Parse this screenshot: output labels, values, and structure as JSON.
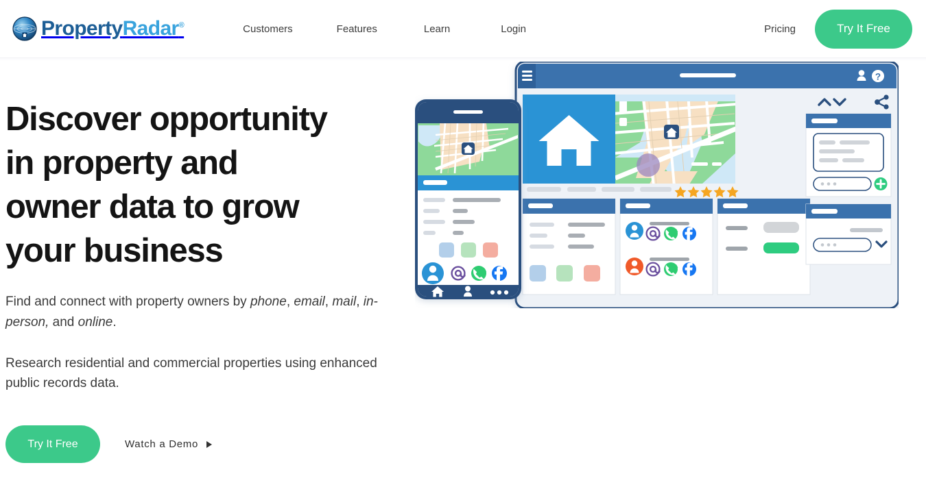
{
  "header": {
    "logo": {
      "icon": "globe-radar-icon",
      "word1": "Property",
      "word2": "Radar",
      "registered": "®"
    },
    "nav": [
      {
        "label": "Customers",
        "name": "customers"
      },
      {
        "label": "Features",
        "name": "features"
      },
      {
        "label": "Learn",
        "name": "learn"
      },
      {
        "label": "Login",
        "name": "login"
      }
    ],
    "pricing_label": "Pricing",
    "cta_label": "Try It Free"
  },
  "hero": {
    "title_line1": "Discover opportunity",
    "title_line2": "in property and",
    "title_line3": "owner data to grow",
    "title_line4": "your business",
    "sub_lead": "Find and connect with property owners by ",
    "sub_em1": "phone",
    "sub_sep1": ", ",
    "sub_em2": "email",
    "sub_sep2": ", ",
    "sub_em3": "mail",
    "sub_sep3": ", ",
    "sub_em4": "in-person,",
    "sub_and": " and ",
    "sub_em5": "online",
    "sub_end": ".",
    "paragraph2": "Research residential and commercial properties using enhanced public records data.",
    "cta_primary": "Try It Free",
    "cta_secondary": "Watch a Demo",
    "cta_secondary_icon": "play-triangle-icon"
  },
  "illustration": {
    "name": "property-app-illustration",
    "phone": {
      "name": "mobile-phone-mockup",
      "status_bar_icon": "speaker-bar",
      "map_pin_icon": "home-pin-icon",
      "bottom_nav": [
        "home-icon",
        "person-icon",
        "more-dots-icon"
      ],
      "contact_icons": [
        "person-avatar-icon",
        "email-at-icon",
        "whatsapp-phone-icon",
        "facebook-icon"
      ],
      "swatches": [
        "#b3cfea",
        "#b6e3bd",
        "#f4ada0"
      ]
    },
    "dashboard": {
      "name": "desktop-dashboard-mockup",
      "header_icons": [
        "hamburger-menu-icon",
        "person-icon",
        "help-question-icon"
      ],
      "house_tile_icon": "house-icon",
      "map_pin_icon": "home-pin-icon",
      "rating_stars": 5,
      "sidebar_icons": [
        "chevron-up-icon",
        "chevron-down-icon",
        "share-icon",
        "plus-circle-icon",
        "chevron-down-icon"
      ],
      "contacts": [
        {
          "avatar_color": "#2a93d5",
          "icons": [
            "email-at-icon",
            "whatsapp-phone-icon",
            "facebook-icon"
          ]
        },
        {
          "avatar_color": "#f05a2a",
          "icons": [
            "email-at-icon",
            "whatsapp-phone-icon",
            "facebook-icon"
          ]
        }
      ],
      "swatches": [
        "#b3cfea",
        "#b6e3bd",
        "#f4ada0"
      ],
      "action_button_color": "#2ecc80"
    }
  },
  "colors": {
    "brand_green": "#3cc98a",
    "brand_blue_dark": "#1d5e96",
    "brand_blue_light": "#39a3dd",
    "dashboard_header": "#3a72ad",
    "dashboard_bar": "#3a72ad",
    "tile_blue": "#2a93d5",
    "star_orange": "#f5a623",
    "text_dark": "#141414",
    "text_body": "#3a3a3a"
  }
}
